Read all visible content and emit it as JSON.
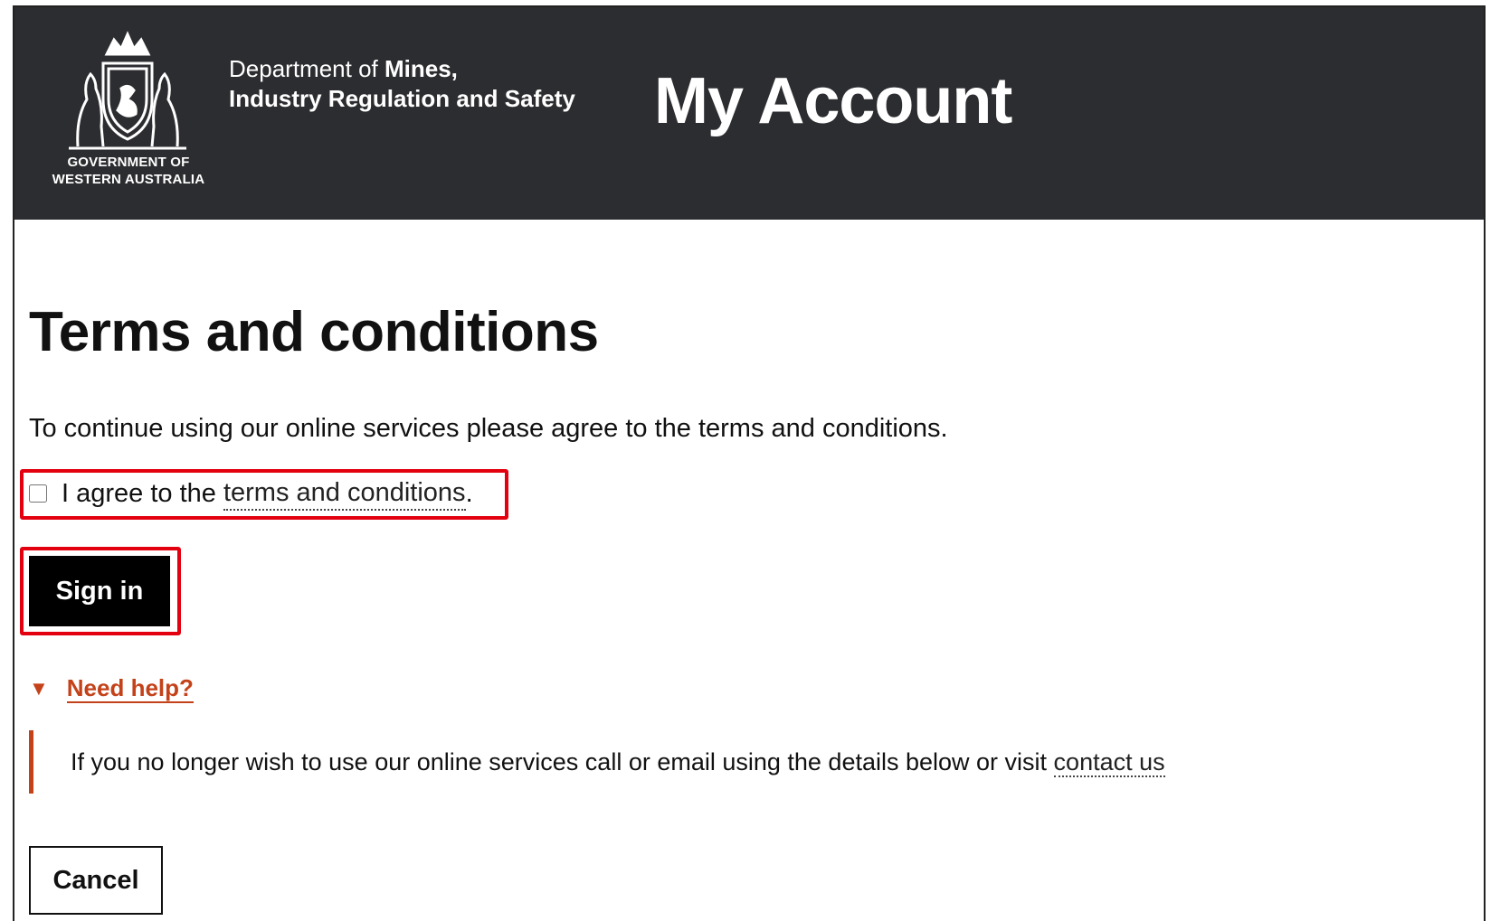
{
  "header": {
    "gov_line1": "GOVERNMENT OF",
    "gov_line2": "WESTERN AUSTRALIA",
    "dept_prefix": "Department of ",
    "dept_bold": "Mines,",
    "dept_line2": "Industry Regulation and Safety",
    "app_title": "My Account",
    "background": "#2c2d30"
  },
  "main": {
    "title": "Terms and conditions",
    "intro": "To continue using our online services please agree to the terms and conditions.",
    "agree_prefix": "I agree to the ",
    "agree_link": "terms and conditions",
    "agree_suffix": ".",
    "agree_checked": false,
    "sign_in_label": "Sign in",
    "cancel_label": "Cancel"
  },
  "help": {
    "toggle_label": "Need help?",
    "text": "If you no longer wish to use our online services call or email using the details below or visit ",
    "contact_link": "contact us",
    "accent_color": "#c4421a"
  },
  "annotations": {
    "highlight_color": "#e3000f"
  }
}
